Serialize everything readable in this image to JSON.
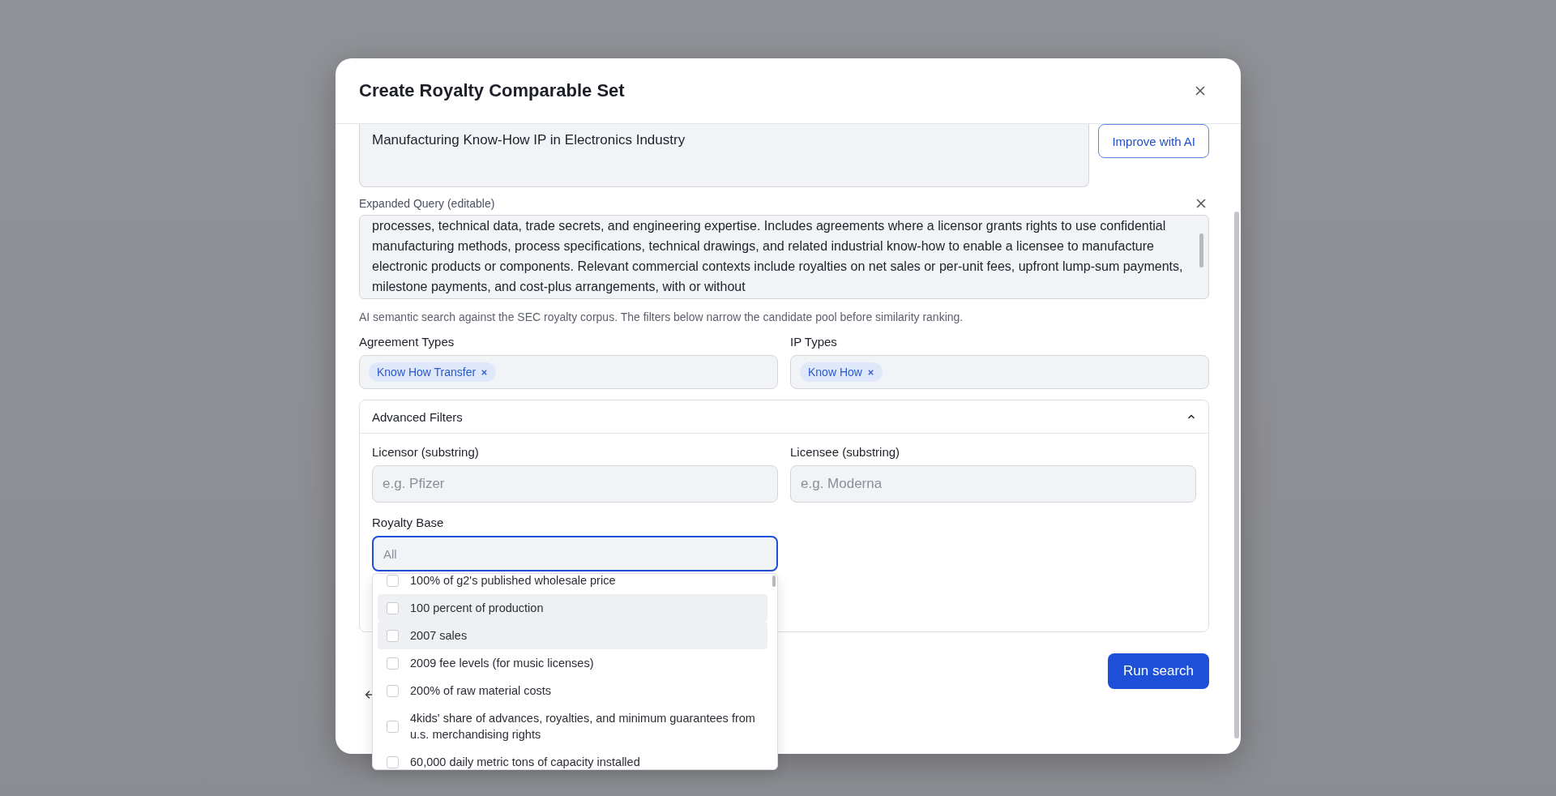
{
  "dialog": {
    "title": "Create Royalty Comparable Set"
  },
  "query": {
    "value": "Manufacturing Know-How IP in Electronics Industry"
  },
  "improve_button": "Improve with AI",
  "expanded_query": {
    "label": "Expanded Query (editable)",
    "value": "processes, technical data, trade secrets, and engineering expertise. Includes agreements where a licensor grants rights to use confidential manufacturing methods, process specifications, technical drawings, and related industrial know-how to enable a licensee to manufacture electronic products or components. Relevant commercial contexts include royalties on net sales or per-unit fees, upfront lump-sum payments, milestone payments, and cost-plus arrangements, with or without"
  },
  "help_text": "AI semantic search against the SEC royalty corpus. The filters below narrow the candidate pool before similarity ranking.",
  "agreement_types": {
    "label": "Agreement Types",
    "chips": [
      "Know How Transfer"
    ]
  },
  "ip_types": {
    "label": "IP Types",
    "chips": [
      "Know How"
    ]
  },
  "advanced_filters": {
    "title": "Advanced Filters",
    "expanded": true,
    "licensor": {
      "label": "Licensor (substring)",
      "placeholder": "e.g. Pfizer"
    },
    "licensee": {
      "label": "Licensee (substring)",
      "placeholder": "e.g. Moderna"
    },
    "royalty_base": {
      "label": "Royalty Base",
      "placeholder": "All",
      "options": [
        {
          "label": "100% of g2's published wholesale price",
          "checked": false,
          "highlighted": false
        },
        {
          "label": "100 percent of production",
          "checked": false,
          "highlighted": true
        },
        {
          "label": "2007 sales",
          "checked": false,
          "highlighted": true
        },
        {
          "label": "2009 fee levels (for music licenses)",
          "checked": false,
          "highlighted": false
        },
        {
          "label": "200% of raw material costs",
          "checked": false,
          "highlighted": false
        },
        {
          "label": "4kids' share of advances, royalties, and minimum guarantees from u.s. merchandising rights",
          "checked": false,
          "highlighted": false
        },
        {
          "label": "60,000 daily metric tons of capacity installed",
          "checked": false,
          "highlighted": false
        }
      ]
    }
  },
  "run_button": "Run search"
}
